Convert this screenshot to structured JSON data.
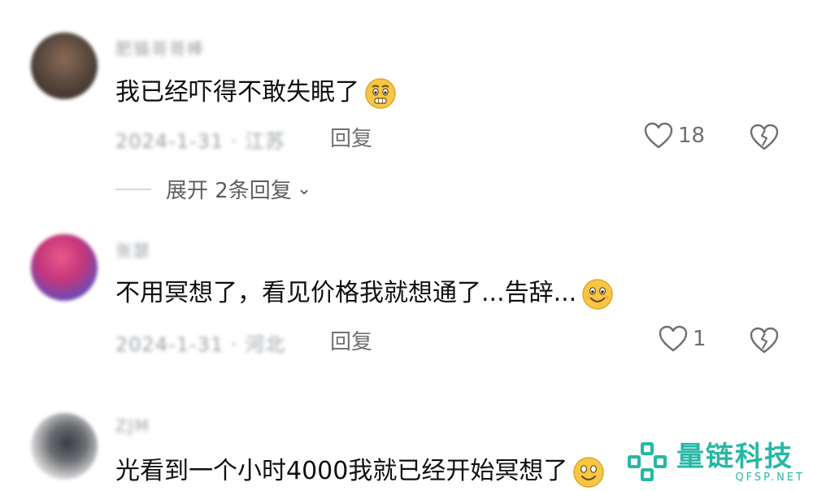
{
  "comments": [
    {
      "username": "肥猫哥哥棒",
      "text": "我已经吓得不敢失眠了",
      "emoji": "worried-face",
      "date": "2024-1-31 · 江苏",
      "reply_label": "回复",
      "likes": "18",
      "expand_label": "展开 2条回复"
    },
    {
      "username": "张瑟",
      "text": "不用冥想了，看见价格我就想通了...告辞...",
      "emoji": "smiling-face",
      "date": "2024-1-31 · 河北",
      "reply_label": "回复",
      "likes": "1"
    },
    {
      "username": "ZJM",
      "text": "光看到一个小时4000我就已经开始冥想了",
      "emoji": "smiling-face"
    }
  ],
  "watermark": {
    "title": "量链科技",
    "subtitle": "QFSP.NET",
    "color": "#26b8a6"
  },
  "colors": {
    "text": "#101010",
    "meta": "#707070",
    "emoji": "#f7c744"
  }
}
